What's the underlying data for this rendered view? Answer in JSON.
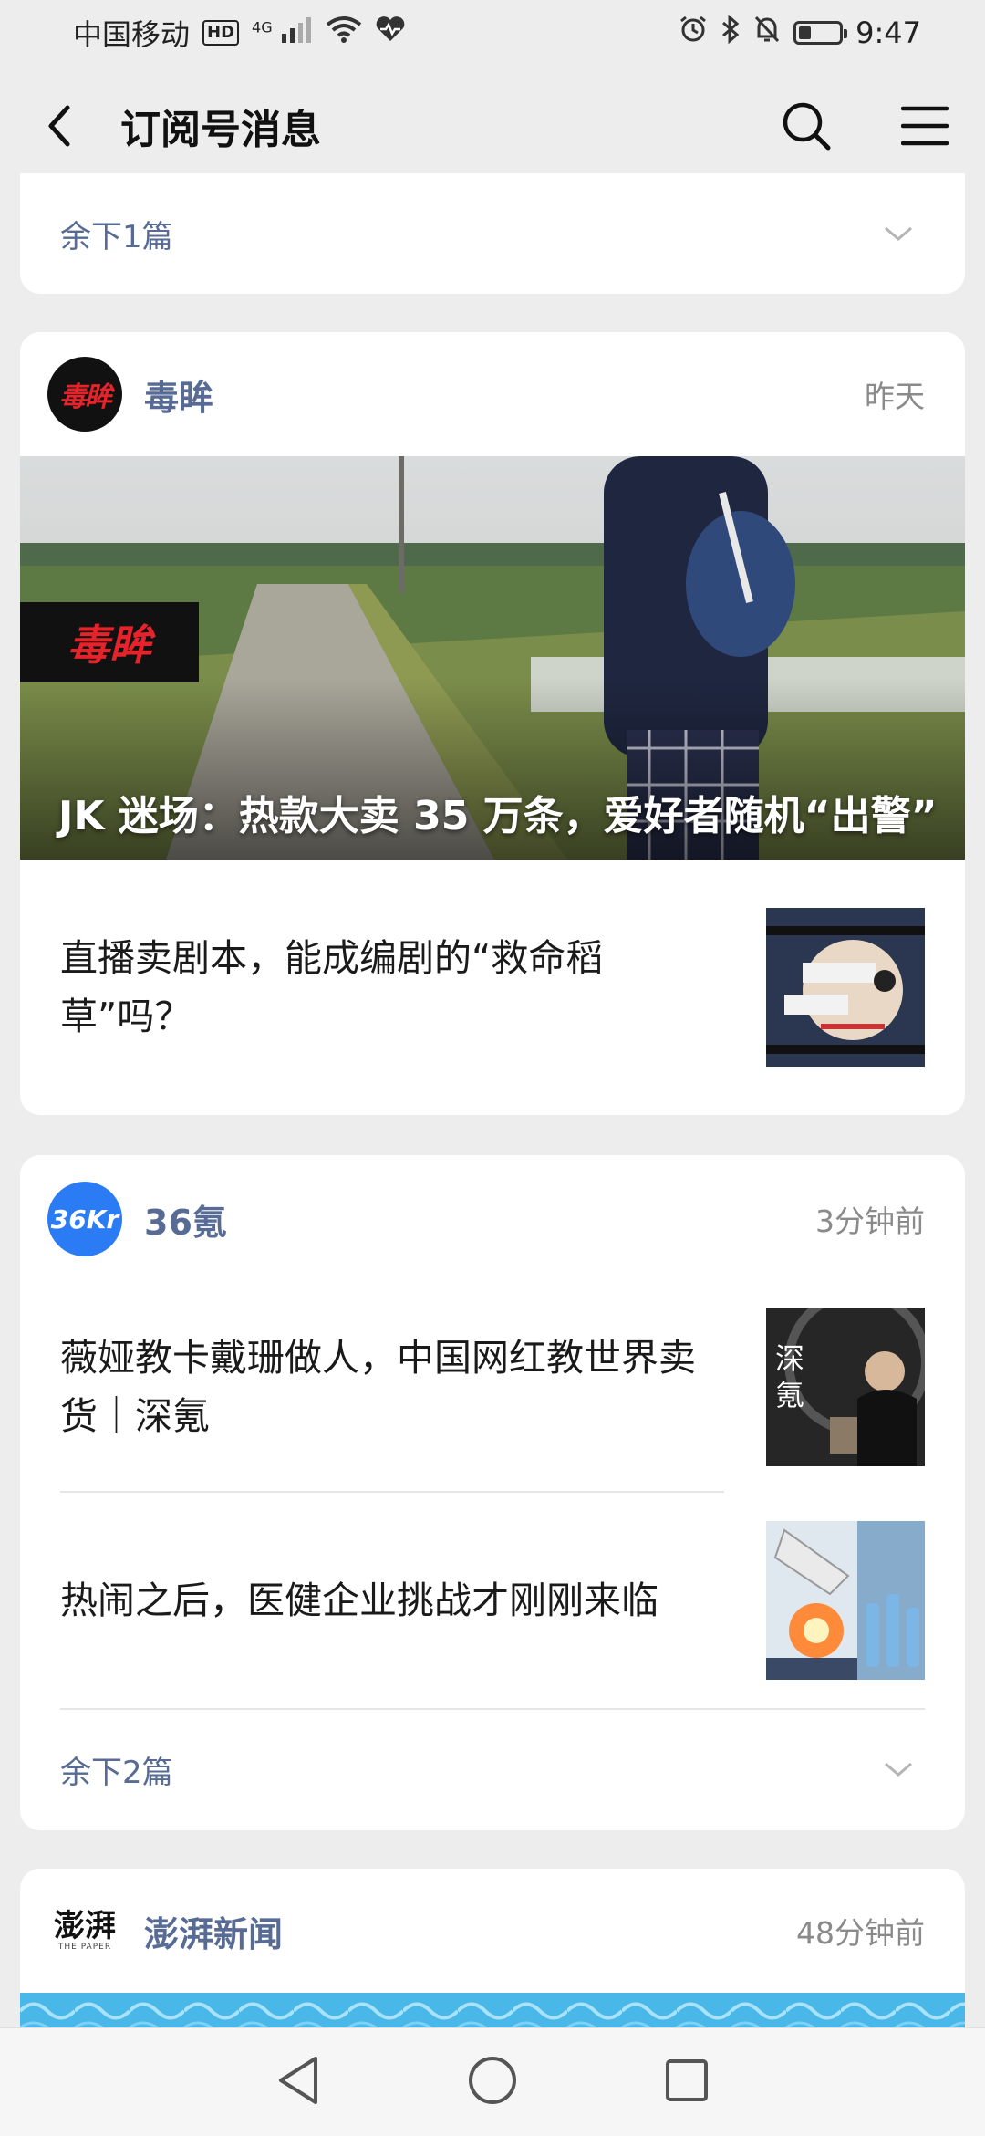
{
  "status_bar": {
    "carrier": "中国移动",
    "hd": "HD",
    "net": "4G",
    "time": "9:47",
    "battery_level": 0.3
  },
  "nav": {
    "title": "订阅号消息",
    "icons": [
      "back-arrow-icon",
      "search-icon",
      "menu-icon"
    ]
  },
  "top_card": {
    "more_label": "余下1篇"
  },
  "card_dumou": {
    "name": "毒眸",
    "avatar_text": "毒眸",
    "time": "昨天",
    "hero_logo_text": "毒眸",
    "hero_title": "JK 迷场：热款大卖 35 万条，爱好者随机“出警”",
    "articles": [
      {
        "title": "直播卖剧本，能成编剧的“救命稻草”吗？"
      }
    ]
  },
  "card_36kr": {
    "name": "36氪",
    "avatar_text": "36Kr",
    "time": "3分钟前",
    "articles": [
      {
        "title": "薇娅教卡戴珊做人，中国网红教世界卖货｜深氪",
        "thumb_text": "深氪"
      },
      {
        "title": "热闹之后，医健企业挑战才刚刚来临"
      }
    ],
    "more_label": "余下2篇"
  },
  "card_thepaper": {
    "name": "澎湃新闻",
    "avatar_text": "澎湃",
    "avatar_subtext": "THE PAPER",
    "time": "48分钟前"
  },
  "colors": {
    "link_blue": "#576b95",
    "background": "#ededed",
    "accent_red": "#e4232a",
    "kr_blue": "#2a7bf4"
  }
}
